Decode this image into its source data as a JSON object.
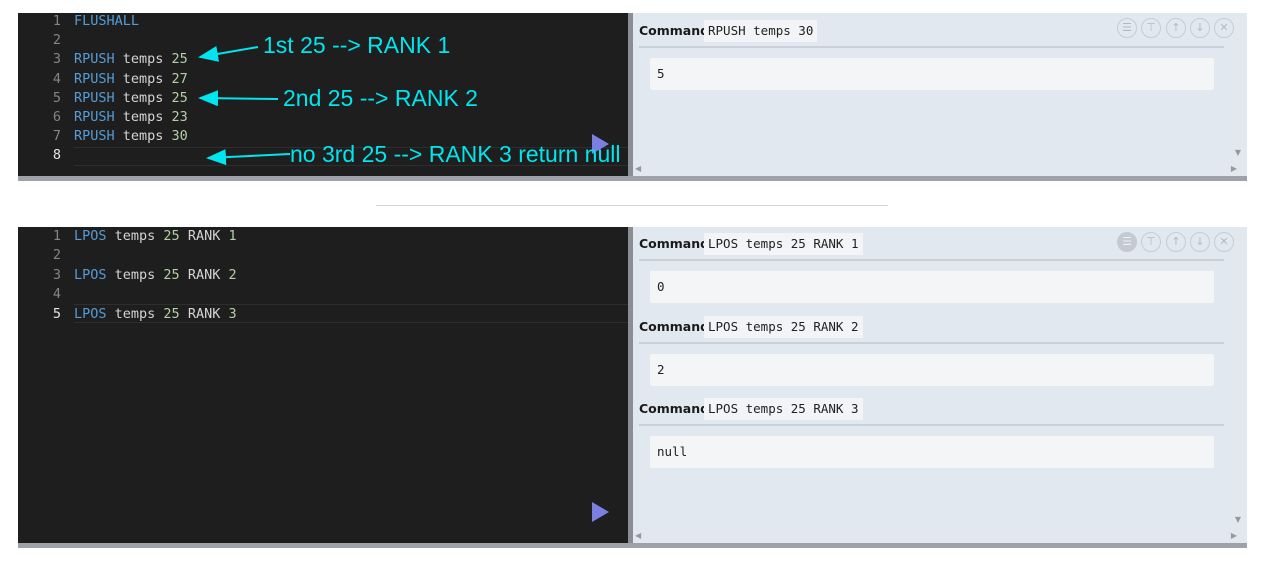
{
  "top": {
    "editor_lines": [
      {
        "num": "1",
        "tokens": [
          {
            "t": "FLUSHALL",
            "c": "kw"
          }
        ]
      },
      {
        "num": "2",
        "tokens": []
      },
      {
        "num": "3",
        "tokens": [
          {
            "t": "RPUSH",
            "c": "kw"
          },
          {
            "t": " temps ",
            "c": "id"
          },
          {
            "t": "25",
            "c": "num"
          }
        ]
      },
      {
        "num": "4",
        "tokens": [
          {
            "t": "RPUSH",
            "c": "kw"
          },
          {
            "t": " temps ",
            "c": "id"
          },
          {
            "t": "27",
            "c": "num"
          }
        ]
      },
      {
        "num": "5",
        "tokens": [
          {
            "t": "RPUSH",
            "c": "kw"
          },
          {
            "t": " temps ",
            "c": "id"
          },
          {
            "t": "25",
            "c": "num"
          }
        ]
      },
      {
        "num": "6",
        "tokens": [
          {
            "t": "RPUSH",
            "c": "kw"
          },
          {
            "t": " temps ",
            "c": "id"
          },
          {
            "t": "23",
            "c": "num"
          }
        ]
      },
      {
        "num": "7",
        "tokens": [
          {
            "t": "RPUSH",
            "c": "kw"
          },
          {
            "t": " temps ",
            "c": "id"
          },
          {
            "t": "30",
            "c": "num"
          }
        ]
      },
      {
        "num": "8",
        "tokens": [],
        "active": true
      }
    ],
    "results": [
      {
        "label": "Command",
        "command": "RPUSH temps 30",
        "output": "5"
      }
    ]
  },
  "bottom": {
    "editor_lines": [
      {
        "num": "1",
        "tokens": [
          {
            "t": "LPOS",
            "c": "kw"
          },
          {
            "t": " temps ",
            "c": "id"
          },
          {
            "t": "25",
            "c": "num"
          },
          {
            "t": " RANK ",
            "c": "id"
          },
          {
            "t": "1",
            "c": "num"
          }
        ]
      },
      {
        "num": "2",
        "tokens": []
      },
      {
        "num": "3",
        "tokens": [
          {
            "t": "LPOS",
            "c": "kw"
          },
          {
            "t": " temps ",
            "c": "id"
          },
          {
            "t": "25",
            "c": "num"
          },
          {
            "t": " RANK ",
            "c": "id"
          },
          {
            "t": "2",
            "c": "num"
          }
        ]
      },
      {
        "num": "4",
        "tokens": []
      },
      {
        "num": "5",
        "tokens": [
          {
            "t": "LPOS",
            "c": "kw"
          },
          {
            "t": " temps ",
            "c": "id"
          },
          {
            "t": "25",
            "c": "num"
          },
          {
            "t": " RANK ",
            "c": "id"
          },
          {
            "t": "3",
            "c": "num"
          }
        ],
        "active": true
      }
    ],
    "results": [
      {
        "label": "Command",
        "command": "LPOS temps 25 RANK 1",
        "output": "0"
      },
      {
        "label": "Command",
        "command": "LPOS temps 25 RANK 2",
        "output": "2"
      },
      {
        "label": "Command",
        "command": "LPOS temps 25 RANK 3",
        "output": "null"
      }
    ]
  },
  "annotations": {
    "first": "1st 25 --> RANK 1",
    "second": "2nd 25 --> RANK 2",
    "third": "no 3rd 25 --> RANK 3 return null"
  },
  "toolbar_icons": [
    "list-icon",
    "paint-roller-icon",
    "arrow-up-icon",
    "arrow-down-icon",
    "close-icon"
  ],
  "colors": {
    "editor_bg": "#1e1e1e",
    "output_bg": "#e1e8f0",
    "keyword": "#569cd6",
    "number": "#b5cea8",
    "annotation": "#00e5ee",
    "run_button": "#7b7fe0"
  }
}
